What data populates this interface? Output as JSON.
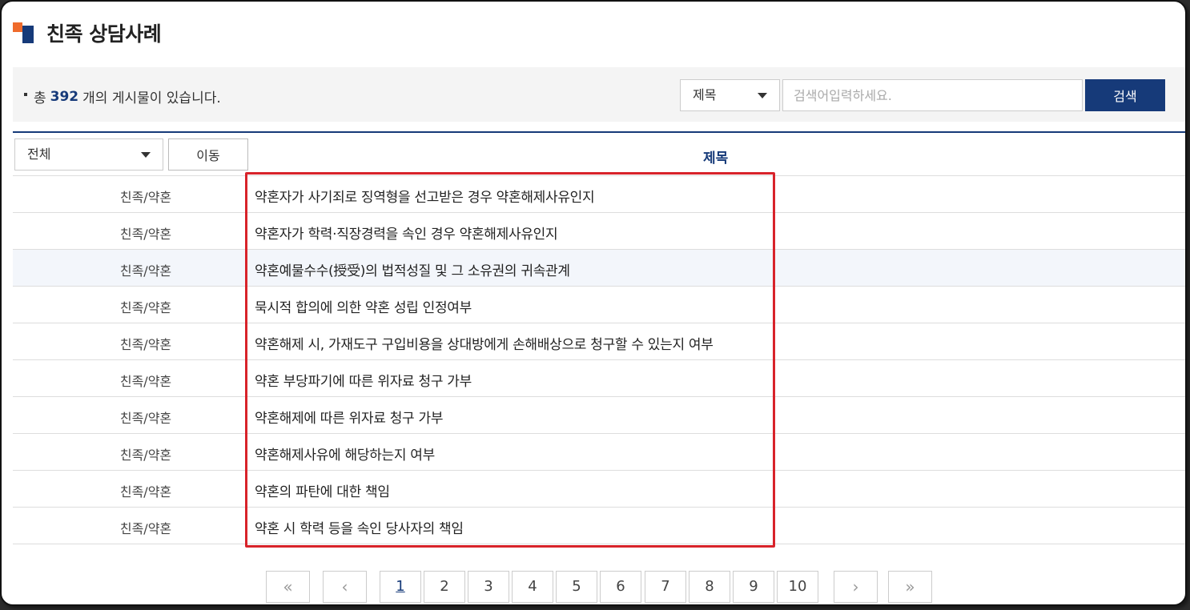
{
  "page": {
    "title": "친족 상담사례"
  },
  "search": {
    "count_prefix": "총",
    "count": "392",
    "count_suffix": "개의 게시물이 있습니다.",
    "field_selected": "제목",
    "placeholder": "검색어입력하세요.",
    "button_label": "검색"
  },
  "table": {
    "category_selected": "전체",
    "move_label": "이동",
    "subject_header": "제목",
    "rows": [
      {
        "category": "친족/약혼",
        "subject": "약혼자가 사기죄로 징역형을 선고받은 경우 약혼해제사유인지"
      },
      {
        "category": "친족/약혼",
        "subject": "약혼자가 학력·직장경력을 속인 경우 약혼해제사유인지"
      },
      {
        "category": "친족/약혼",
        "subject": "약혼예물수수(授受)의 법적성질 및 그 소유권의 귀속관계"
      },
      {
        "category": "친족/약혼",
        "subject": "묵시적 합의에 의한 약혼 성립 인정여부"
      },
      {
        "category": "친족/약혼",
        "subject": "약혼해제 시, 가재도구 구입비용을 상대방에게 손해배상으로 청구할 수 있는지 여부"
      },
      {
        "category": "친족/약혼",
        "subject": "약혼 부당파기에 따른 위자료 청구 가부"
      },
      {
        "category": "친족/약혼",
        "subject": "약혼해제에 따른 위자료 청구 가부"
      },
      {
        "category": "친족/약혼",
        "subject": "약혼해제사유에 해당하는지 여부"
      },
      {
        "category": "친족/약혼",
        "subject": "약혼의 파탄에 대한 책임"
      },
      {
        "category": "친족/약혼",
        "subject": "약혼 시 학력 등을 속인 당사자의 책임"
      }
    ]
  },
  "pagination": {
    "first": "«",
    "prev": "‹",
    "pages": [
      "1",
      "2",
      "3",
      "4",
      "5",
      "6",
      "7",
      "8",
      "9",
      "10"
    ],
    "next": "›",
    "last": "»"
  },
  "colors": {
    "brand_navy": "#163a79",
    "brand_orange": "#ef6b2c",
    "highlight_red": "#d8232a"
  }
}
